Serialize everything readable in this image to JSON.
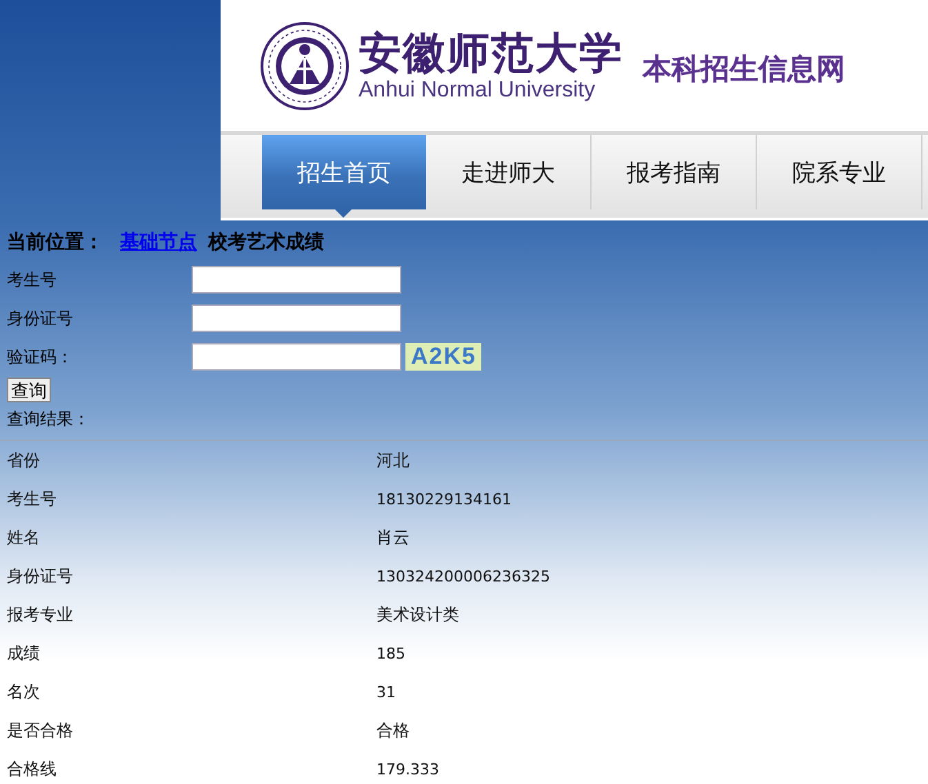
{
  "header": {
    "university_name": "安徽师范大学",
    "university_name_en": "Anhui Normal University",
    "site_title": "本科招生信息网"
  },
  "nav": [
    {
      "label": "招生首页",
      "selected": true
    },
    {
      "label": "走进师大",
      "selected": false
    },
    {
      "label": "报考指南",
      "selected": false
    },
    {
      "label": "院系专业",
      "selected": false
    }
  ],
  "breadcrumb": {
    "label": "当前位置：",
    "link": "基础节点",
    "current": "校考艺术成绩"
  },
  "form": {
    "fields": [
      {
        "label": "考生号",
        "kind": "text"
      },
      {
        "label": "身份证号",
        "kind": "text"
      },
      {
        "label": "验证码：",
        "kind": "captcha",
        "captcha": "A2K5"
      }
    ],
    "submit": "查询",
    "results_label": "查询结果："
  },
  "results": [
    {
      "label": "省份",
      "value": "河北"
    },
    {
      "label": "考生号",
      "value": "18130229134161"
    },
    {
      "label": "姓名",
      "value": "肖云"
    },
    {
      "label": "身份证号",
      "value": "130324200006236325"
    },
    {
      "label": "报考专业",
      "value": "美术设计类"
    },
    {
      "label": "成绩",
      "value": "185"
    },
    {
      "label": "名次",
      "value": "31"
    },
    {
      "label": "是否合格",
      "value": "合格"
    },
    {
      "label": "合格线",
      "value": "179.333"
    }
  ]
}
